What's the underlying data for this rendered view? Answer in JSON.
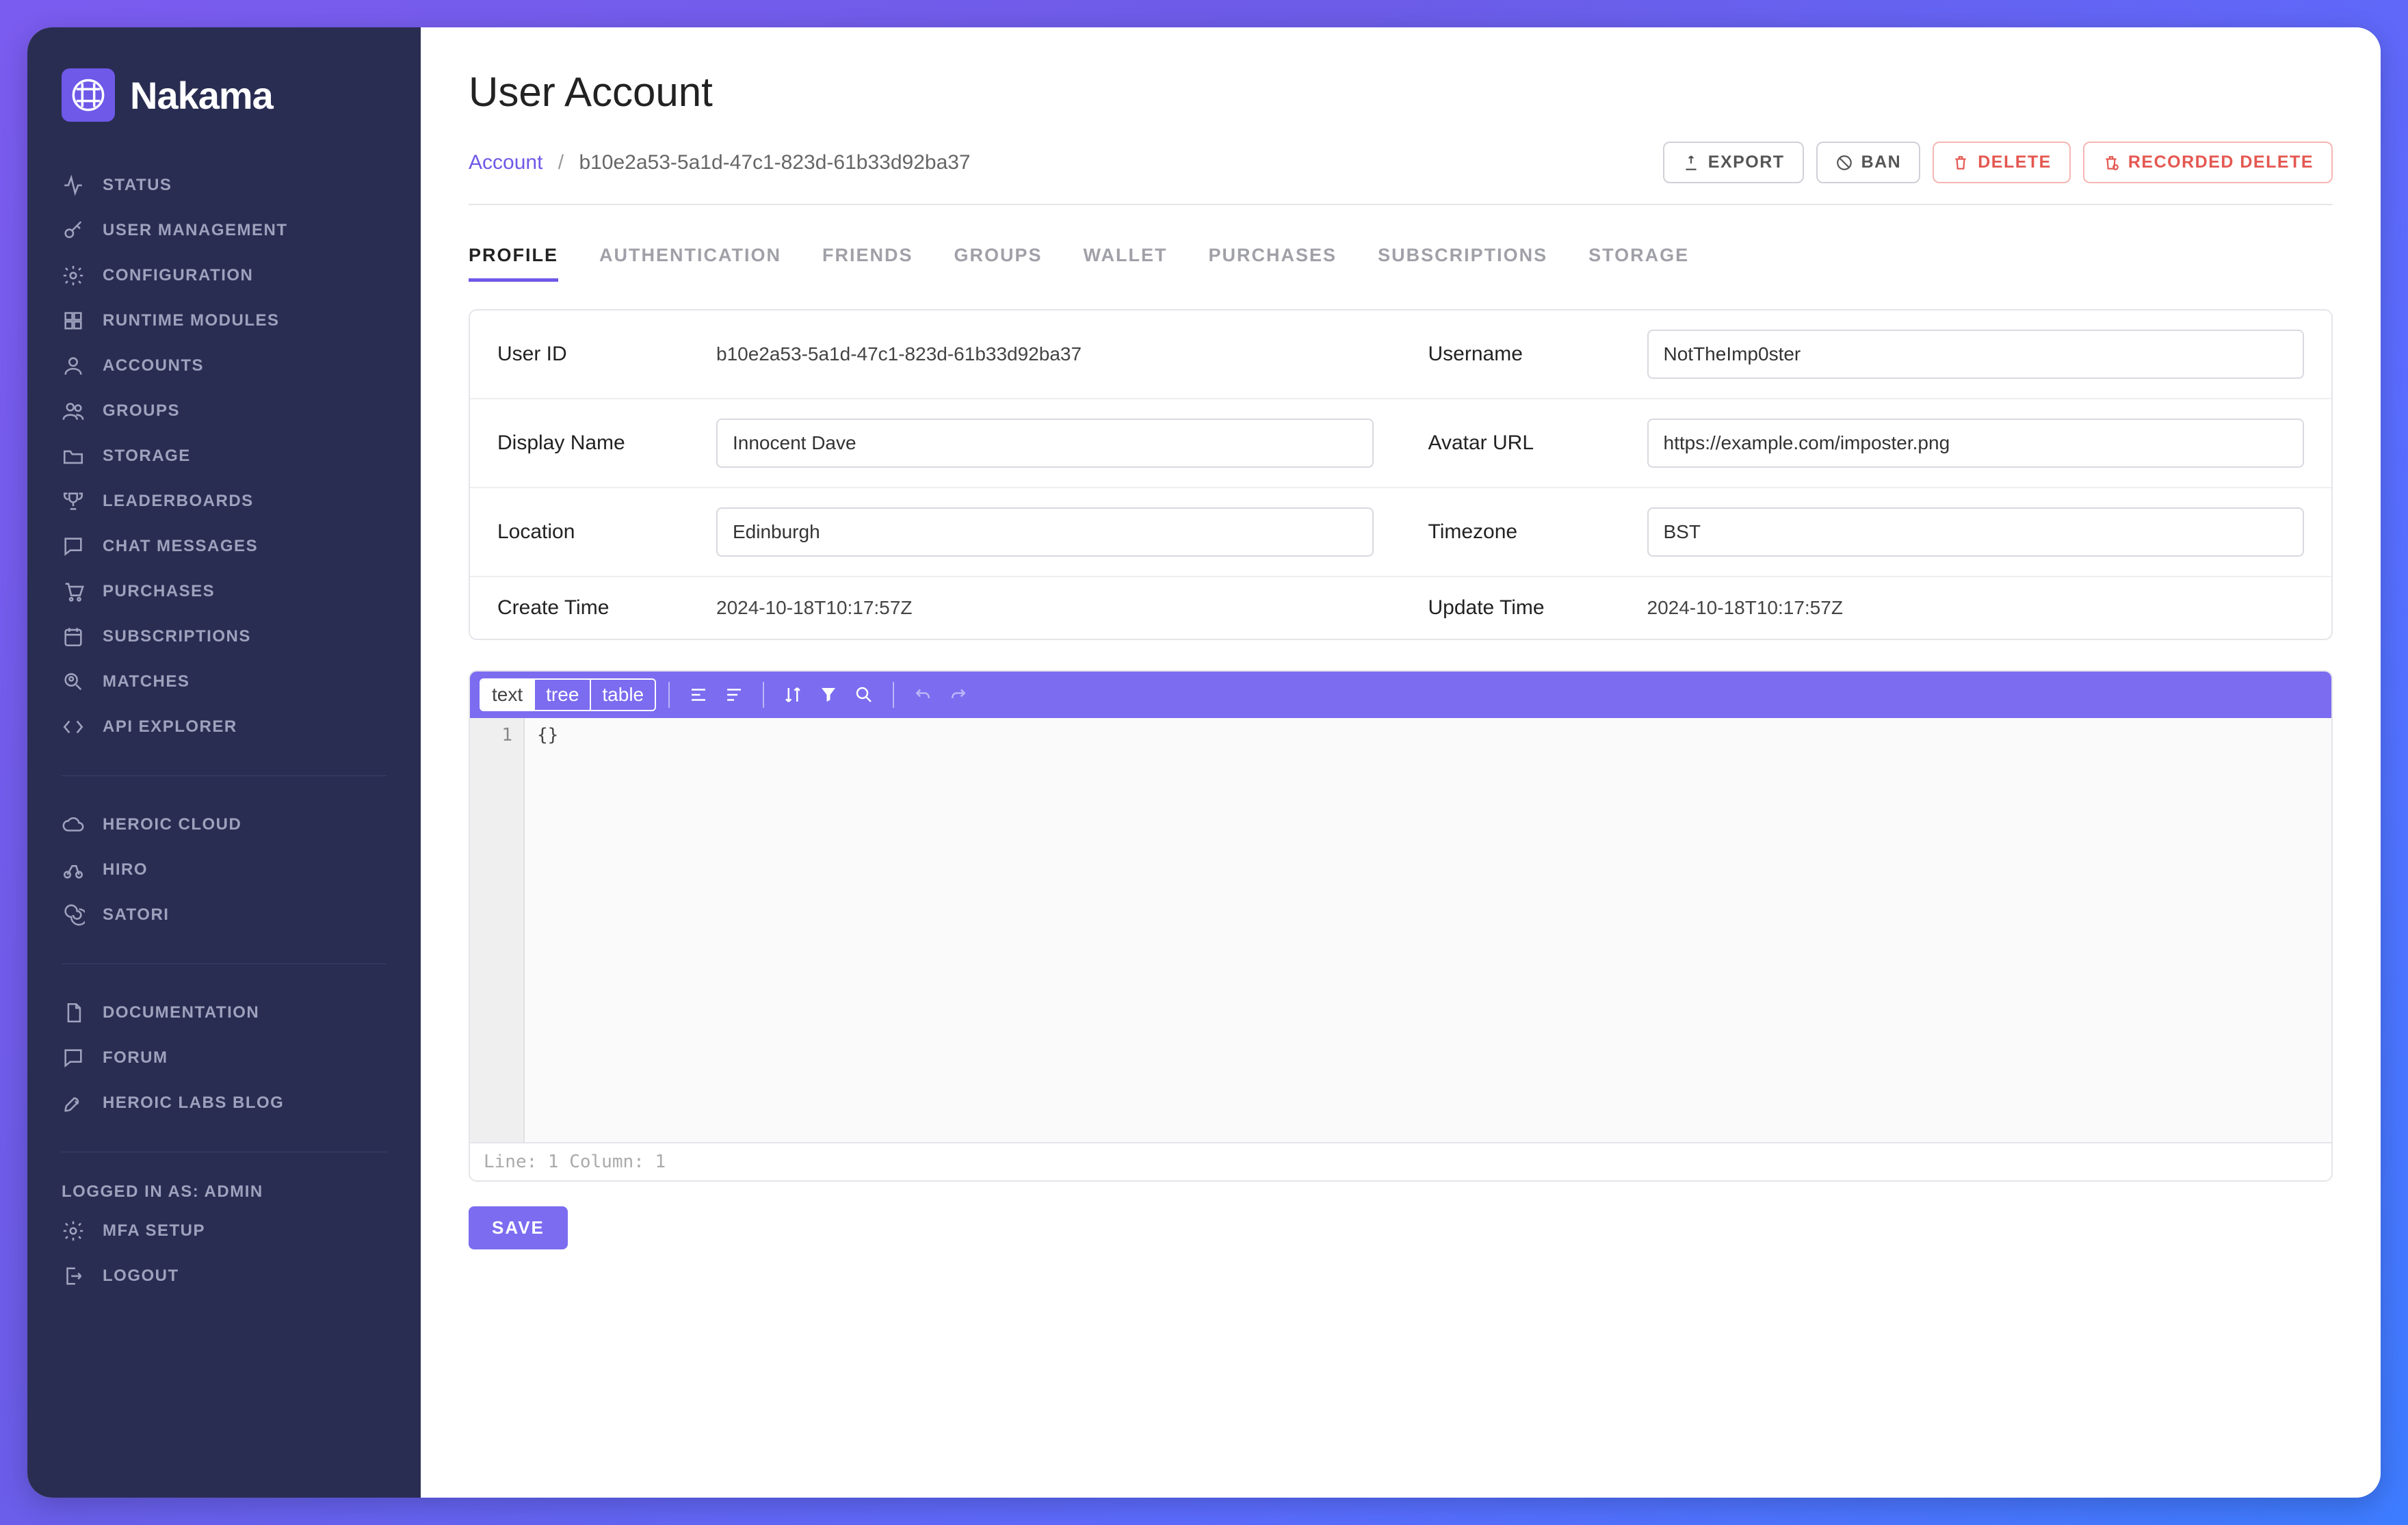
{
  "brand": "Nakama",
  "sidebar": {
    "groups": [
      [
        {
          "label": "STATUS",
          "icon": "activity"
        },
        {
          "label": "USER MANAGEMENT",
          "icon": "key"
        },
        {
          "label": "CONFIGURATION",
          "icon": "gear"
        },
        {
          "label": "RUNTIME MODULES",
          "icon": "module"
        },
        {
          "label": "ACCOUNTS",
          "icon": "user"
        },
        {
          "label": "GROUPS",
          "icon": "users"
        },
        {
          "label": "STORAGE",
          "icon": "folder"
        },
        {
          "label": "LEADERBOARDS",
          "icon": "trophy"
        },
        {
          "label": "CHAT MESSAGES",
          "icon": "chat"
        },
        {
          "label": "PURCHASES",
          "icon": "cart"
        },
        {
          "label": "SUBSCRIPTIONS",
          "icon": "calendar"
        },
        {
          "label": "MATCHES",
          "icon": "search-user"
        },
        {
          "label": "API EXPLORER",
          "icon": "code"
        }
      ],
      [
        {
          "label": "HEROIC CLOUD",
          "icon": "cloud"
        },
        {
          "label": "HIRO",
          "icon": "bike"
        },
        {
          "label": "SATORI",
          "icon": "spiral"
        }
      ],
      [
        {
          "label": "DOCUMENTATION",
          "icon": "doc"
        },
        {
          "label": "FORUM",
          "icon": "chat"
        },
        {
          "label": "HEROIC LABS BLOG",
          "icon": "rocket"
        }
      ]
    ],
    "loggedInAs": "LOGGED IN AS: ADMIN",
    "footer": [
      {
        "label": "MFA SETUP",
        "icon": "gear"
      },
      {
        "label": "LOGOUT",
        "icon": "logout"
      }
    ]
  },
  "page": {
    "title": "User Account",
    "breadcrumb": {
      "root": "Account",
      "id": "b10e2a53-5a1d-47c1-823d-61b33d92ba37"
    },
    "actions": [
      {
        "label": "EXPORT",
        "icon": "export",
        "danger": false
      },
      {
        "label": "BAN",
        "icon": "ban",
        "danger": false
      },
      {
        "label": "DELETE",
        "icon": "trash",
        "danger": true
      },
      {
        "label": "RECORDED DELETE",
        "icon": "trash-rec",
        "danger": true
      }
    ],
    "tabs": [
      "PROFILE",
      "AUTHENTICATION",
      "FRIENDS",
      "GROUPS",
      "WALLET",
      "PURCHASES",
      "SUBSCRIPTIONS",
      "STORAGE"
    ],
    "activeTab": 0
  },
  "profile": {
    "user_id_label": "User ID",
    "user_id": "b10e2a53-5a1d-47c1-823d-61b33d92ba37",
    "username_label": "Username",
    "username": "NotTheImp0ster",
    "display_name_label": "Display Name",
    "display_name": "Innocent Dave",
    "avatar_url_label": "Avatar URL",
    "avatar_url": "https://example.com/imposter.png",
    "location_label": "Location",
    "location": "Edinburgh",
    "timezone_label": "Timezone",
    "timezone": "BST",
    "create_time_label": "Create Time",
    "create_time": "2024-10-18T10:17:57Z",
    "update_time_label": "Update Time",
    "update_time": "2024-10-18T10:17:57Z"
  },
  "editor": {
    "modes": [
      "text",
      "tree",
      "table"
    ],
    "activeMode": 0,
    "lineNumber": "1",
    "content": "{}",
    "status": "Line: 1  Column: 1"
  },
  "save_label": "SAVE"
}
